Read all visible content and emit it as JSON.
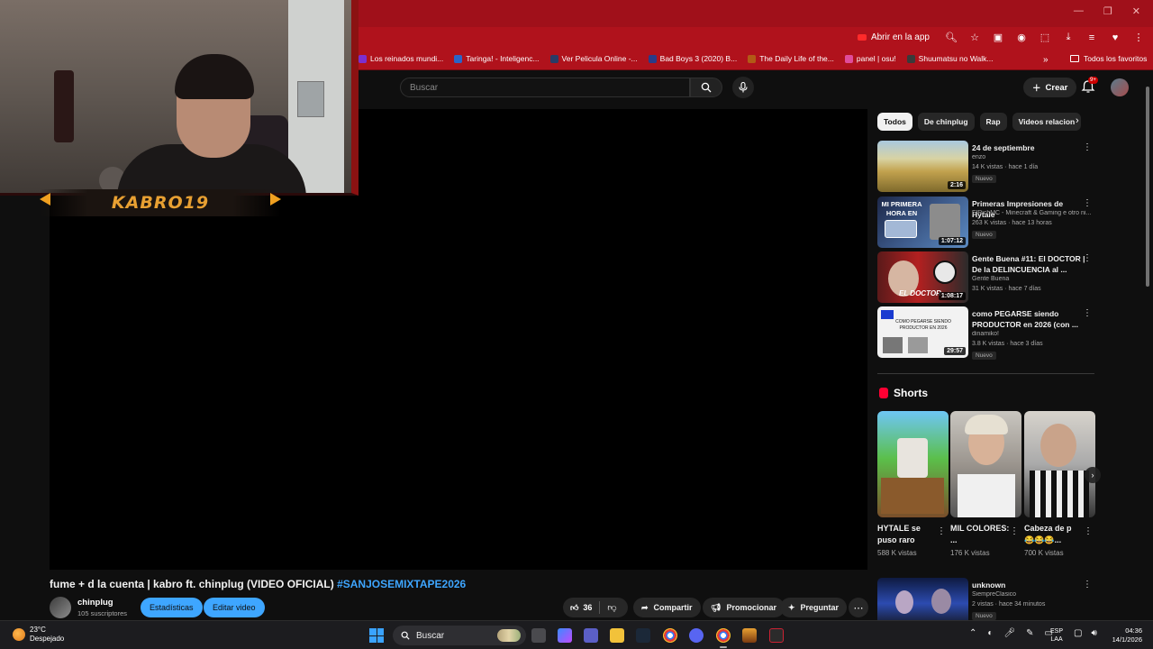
{
  "browser": {
    "open_in_app": "Abrir en la app",
    "bookmarks": [
      {
        "label": "Los reinados mundi...",
        "color": "#7b2fd0"
      },
      {
        "label": "Taringa! - Inteligenc...",
        "color": "#2a64c8"
      },
      {
        "label": "Ver Pelicula Online -...",
        "color": "#2a3b66"
      },
      {
        "label": "Bad Boys 3 (2020) B...",
        "color": "#2a3b88"
      },
      {
        "label": "The Daily Life of the...",
        "color": "#b25a16"
      },
      {
        "label": "panel | osu!",
        "color": "#e04c9b"
      },
      {
        "label": "Shuumatsu no Walk...",
        "color": "#3a3a3a"
      }
    ],
    "all_bookmarks": "Todos los favoritos"
  },
  "header": {
    "search_placeholder": "Buscar",
    "create_label": "Crear",
    "notif_count": "9+"
  },
  "webcam": {
    "name": "KABRO19"
  },
  "video": {
    "title": "fume + d la cuenta | kabro ft. chinplug (VIDEO OFICIAL)",
    "hashtag": "#SANJOSEMIXTAPE2026",
    "channel": "chinplug",
    "subscribers": "105 suscriptores",
    "stats_btn": "Estadísticas",
    "edit_btn": "Editar video",
    "likes": "36",
    "share": "Compartir",
    "promote": "Promocionar",
    "ask": "Preguntar"
  },
  "chips": [
    "Todos",
    "De chinplug",
    "Rap",
    "Videos relacion"
  ],
  "recommendations": [
    {
      "title": "24 de septiembre",
      "channel": "enzo",
      "meta": "14 K vistas · hace 1 día",
      "badge": "Nuevo",
      "duration": "2:16"
    },
    {
      "title": "Primeras Impresiones de Hytale",
      "channel": "ElRichMC - Minecraft & Gaming e otro ni...",
      "meta": "263 K vistas · hace 13 horas",
      "badge": "Nuevo",
      "duration": "1:07:12"
    },
    {
      "title": "Gente Buena #11: El DOCTOR | De la DELINCUENCIA al ...",
      "channel": "Gente Buena",
      "meta": "31 K vistas · hace 7 días",
      "badge": "",
      "duration": "1:08:17"
    },
    {
      "title": "como PEGARSE siendo PRODUCTOR en 2026 (con ...",
      "channel": "dinamiko!",
      "meta": "3.8 K vistas · hace 3 días",
      "badge": "Nuevo",
      "duration": "29:57"
    }
  ],
  "thumb_texts": {
    "hytale": "MI PRIMERA HORA EN",
    "doctor": "EL DOCTOR",
    "productor": "COMO PEGARSE SIENDO PRODUCTOR EN 2026"
  },
  "shorts": {
    "heading": "Shorts",
    "items": [
      {
        "title": "HYTALE se puso raro",
        "views": "588 K vistas"
      },
      {
        "title": "MIL COLORES: ...",
        "views": "176 K vistas"
      },
      {
        "title": "Cabeza de p 😂😂😂...",
        "views": "700 K vistas"
      }
    ]
  },
  "bottom_rec": {
    "title": "unknown",
    "channel": "SiempreClasico",
    "meta": "2 vistas · hace 34 minutos",
    "badge": "Nuevo"
  },
  "taskbar": {
    "temp": "23°C",
    "weather": "Despejado",
    "search": "Buscar",
    "lang1": "ESP",
    "lang2": "LAA",
    "time": "04:36",
    "date": "14/1/2026"
  }
}
